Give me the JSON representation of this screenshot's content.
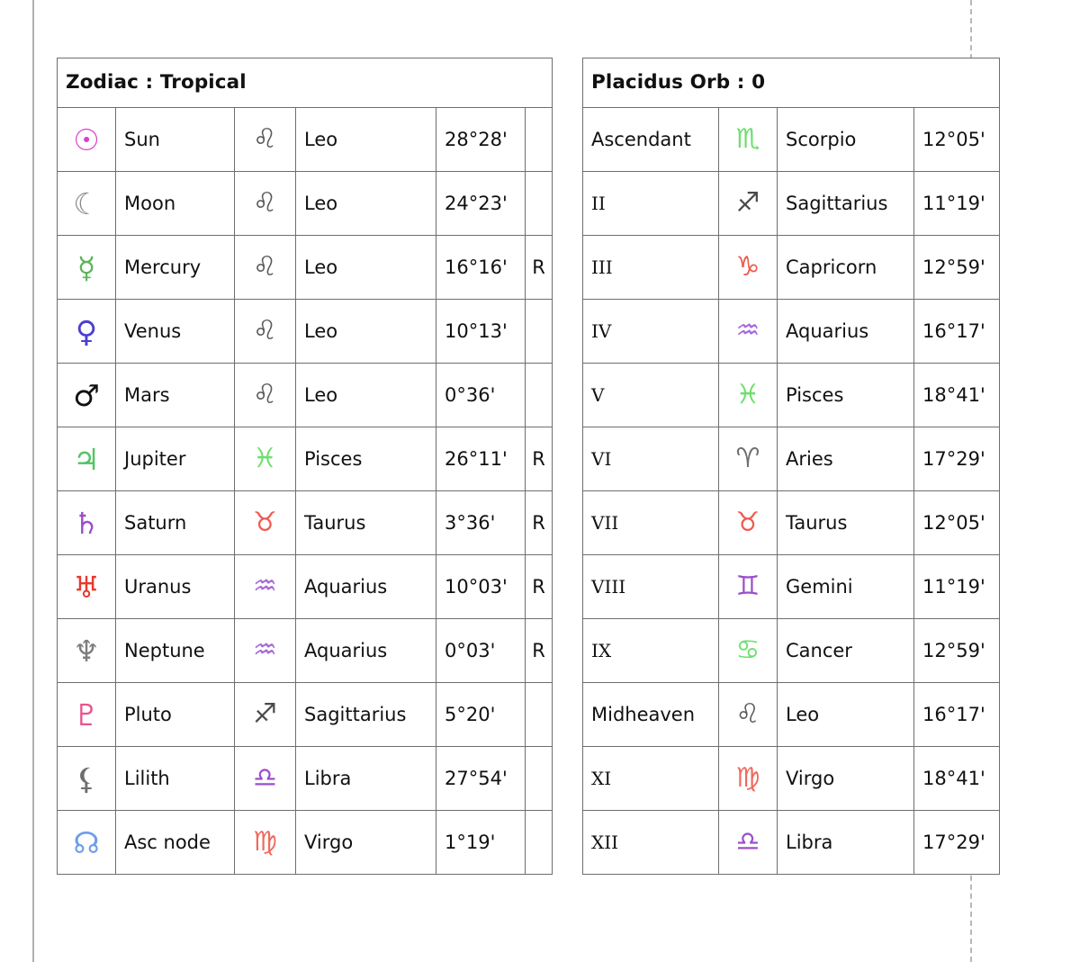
{
  "page": {
    "left_rule": "page-margin-rule",
    "right_rule": "page-dashed-rule"
  },
  "left_table": {
    "header": "Zodiac : Tropical",
    "rows": [
      {
        "glyph": "☉",
        "glyph_name": "sun-symbol",
        "glyph_color": "#d93fd0",
        "body": "Sun",
        "sign_glyph": "♌",
        "sign_glyph_name": "leo-symbol",
        "sign_color": "#5a5a5a",
        "sign": "Leo",
        "degree": "28°28'",
        "retro": ""
      },
      {
        "glyph": "☾",
        "glyph_name": "moon-symbol",
        "glyph_color": "#8a8a8a",
        "body": "Moon",
        "sign_glyph": "♌",
        "sign_glyph_name": "leo-symbol",
        "sign_color": "#5a5a5a",
        "sign": "Leo",
        "degree": "24°23'",
        "retro": ""
      },
      {
        "glyph": "☿",
        "glyph_name": "mercury-symbol",
        "glyph_color": "#5bb45b",
        "body": "Mercury",
        "sign_glyph": "♌",
        "sign_glyph_name": "leo-symbol",
        "sign_color": "#5a5a5a",
        "sign": "Leo",
        "degree": "16°16'",
        "retro": "R"
      },
      {
        "glyph": "♀",
        "glyph_name": "venus-symbol",
        "glyph_color": "#4b3fd0",
        "body": "Venus",
        "sign_glyph": "♌",
        "sign_glyph_name": "leo-symbol",
        "sign_color": "#5a5a5a",
        "sign": "Leo",
        "degree": "10°13'",
        "retro": ""
      },
      {
        "glyph": "♂",
        "glyph_name": "mars-symbol",
        "glyph_color": "#e councils",
        "body": "Mars",
        "sign_glyph": "♌",
        "sign_glyph_name": "leo-symbol",
        "sign_color": "#5a5a5a",
        "sign": "Leo",
        "degree": "0°36'",
        "retro": ""
      },
      {
        "glyph": "♃",
        "glyph_name": "jupiter-symbol",
        "glyph_color": "#52c463",
        "body": "Jupiter",
        "sign_glyph": "♓",
        "sign_glyph_name": "pisces-symbol",
        "sign_color": "#6ddf6d",
        "sign": "Pisces",
        "degree": "26°11'",
        "retro": "R"
      },
      {
        "glyph": "♄",
        "glyph_name": "saturn-symbol",
        "glyph_color": "#9b4fc9",
        "body": "Saturn",
        "sign_glyph": "♉",
        "sign_glyph_name": "taurus-symbol",
        "sign_color": "#ef5b50",
        "sign": "Taurus",
        "degree": "3°36'",
        "retro": "R"
      },
      {
        "glyph": "♅",
        "glyph_name": "uranus-symbol",
        "glyph_color": "#e8392e",
        "body": "Uranus",
        "sign_glyph": "♒",
        "sign_glyph_name": "aquarius-symbol",
        "sign_color": "#a668d8",
        "sign": "Aquarius",
        "degree": "10°03'",
        "retro": "R"
      },
      {
        "glyph": "♆",
        "glyph_name": "neptune-symbol",
        "glyph_color": "#7d7d7d",
        "body": "Neptune",
        "sign_glyph": "♒",
        "sign_glyph_name": "aquarius-symbol",
        "sign_color": "#a668d8",
        "sign": "Aquarius",
        "degree": "0°03'",
        "retro": "R"
      },
      {
        "glyph": "♇",
        "glyph_name": "pluto-symbol",
        "glyph_color": "#e8538e",
        "body": "Pluto",
        "sign_glyph": "♐",
        "sign_glyph_name": "sagittarius-symbol",
        "sign_color": "#4a4a4a",
        "sign": "Sagittarius",
        "degree": "5°20'",
        "retro": ""
      },
      {
        "glyph": "⚸",
        "glyph_name": "lilith-symbol",
        "glyph_color": "#6e6e6e",
        "body": "Lilith",
        "sign_glyph": "♎",
        "sign_glyph_name": "libra-symbol",
        "sign_color": "#9b4fc9",
        "sign": "Libra",
        "degree": "27°54'",
        "retro": ""
      },
      {
        "glyph": "☊",
        "glyph_name": "ascending-node-symbol",
        "glyph_color": "#6e9ee8",
        "body": "Asc node",
        "sign_glyph": "♍",
        "sign_glyph_name": "virgo-symbol",
        "sign_color": "#ef6a5e",
        "sign": "Virgo",
        "degree": "1°19'",
        "retro": ""
      }
    ]
  },
  "right_table": {
    "header": "Placidus Orb : 0",
    "rows": [
      {
        "house": "Ascendant",
        "house_kind": "word",
        "sign_glyph": "♏",
        "sign_glyph_name": "scorpio-symbol",
        "sign_color": "#6ddf6d",
        "sign": "Scorpio",
        "degree": "12°05'"
      },
      {
        "house": "II",
        "house_kind": "roman",
        "sign_glyph": "♐",
        "sign_glyph_name": "sagittarius-symbol",
        "sign_color": "#4a4a4a",
        "sign": "Sagittarius",
        "degree": "11°19'"
      },
      {
        "house": "III",
        "house_kind": "roman",
        "sign_glyph": "♑",
        "sign_glyph_name": "capricorn-symbol",
        "sign_color": "#ef5b50",
        "sign": "Capricorn",
        "degree": "12°59'"
      },
      {
        "house": "IV",
        "house_kind": "roman",
        "sign_glyph": "♒",
        "sign_glyph_name": "aquarius-symbol",
        "sign_color": "#a668d8",
        "sign": "Aquarius",
        "degree": "16°17'"
      },
      {
        "house": "V",
        "house_kind": "roman",
        "sign_glyph": "♓",
        "sign_glyph_name": "pisces-symbol",
        "sign_color": "#6ddf6d",
        "sign": "Pisces",
        "degree": "18°41'"
      },
      {
        "house": "VI",
        "house_kind": "roman",
        "sign_glyph": "♈",
        "sign_glyph_name": "aries-symbol",
        "sign_color": "#6e6e6e",
        "sign": "Aries",
        "degree": "17°29'"
      },
      {
        "house": "VII",
        "house_kind": "roman",
        "sign_glyph": "♉",
        "sign_glyph_name": "taurus-symbol",
        "sign_color": "#ef5b50",
        "sign": "Taurus",
        "degree": "12°05'"
      },
      {
        "house": "VIII",
        "house_kind": "roman",
        "sign_glyph": "♊",
        "sign_glyph_name": "gemini-symbol",
        "sign_color": "#9b4fc9",
        "sign": "Gemini",
        "degree": "11°19'"
      },
      {
        "house": "IX",
        "house_kind": "roman",
        "sign_glyph": "♋",
        "sign_glyph_name": "cancer-symbol",
        "sign_color": "#6ddf6d",
        "sign": "Cancer",
        "degree": "12°59'"
      },
      {
        "house": "Midheaven",
        "house_kind": "word",
        "sign_glyph": "♌",
        "sign_glyph_name": "leo-symbol",
        "sign_color": "#5a5a5a",
        "sign": "Leo",
        "degree": "16°17'"
      },
      {
        "house": "XI",
        "house_kind": "roman",
        "sign_glyph": "♍",
        "sign_glyph_name": "virgo-symbol",
        "sign_color": "#ef6a5e",
        "sign": "Virgo",
        "degree": "18°41'"
      },
      {
        "house": "XII",
        "house_kind": "roman",
        "sign_glyph": "♎",
        "sign_glyph_name": "libra-symbol",
        "sign_color": "#9b4fc9",
        "sign": "Libra",
        "degree": "17°29'"
      }
    ]
  }
}
